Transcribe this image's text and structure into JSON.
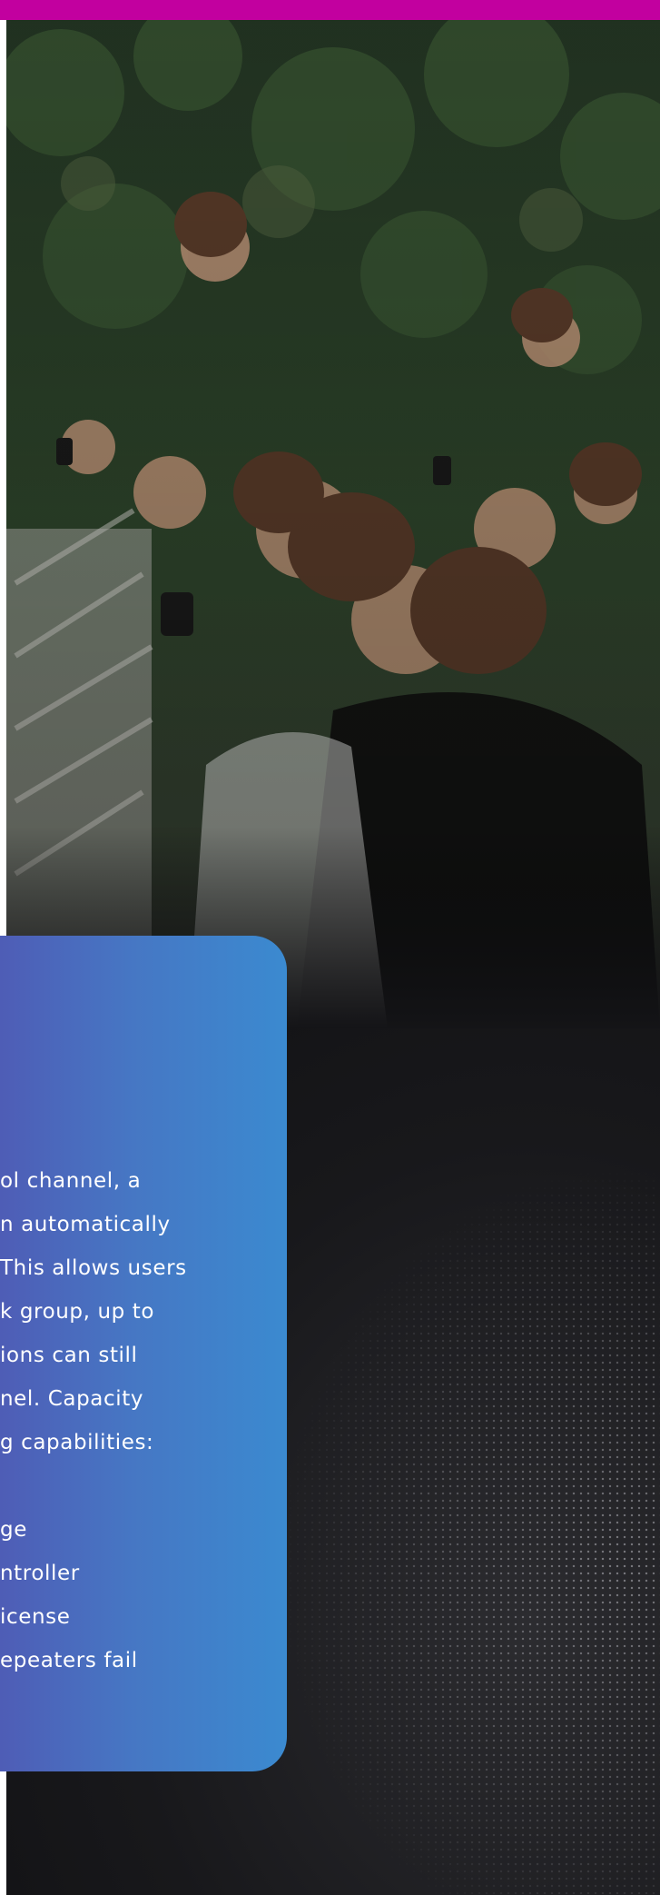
{
  "hero_image": {
    "description_icon": "concert-crowd-photo"
  },
  "colors": {
    "top_bar": "#c2009f",
    "card_start": "#5252b0",
    "card_end": "#3b8ad0",
    "background": "#141417"
  },
  "card": {
    "lines": [
      "ol channel, a",
      "n automatically",
      "This allows users",
      "k group, up to",
      "ions can still",
      "nel. Capacity",
      "g capabilities:",
      "ge",
      "ntroller",
      "icense",
      "epeaters fail"
    ]
  }
}
